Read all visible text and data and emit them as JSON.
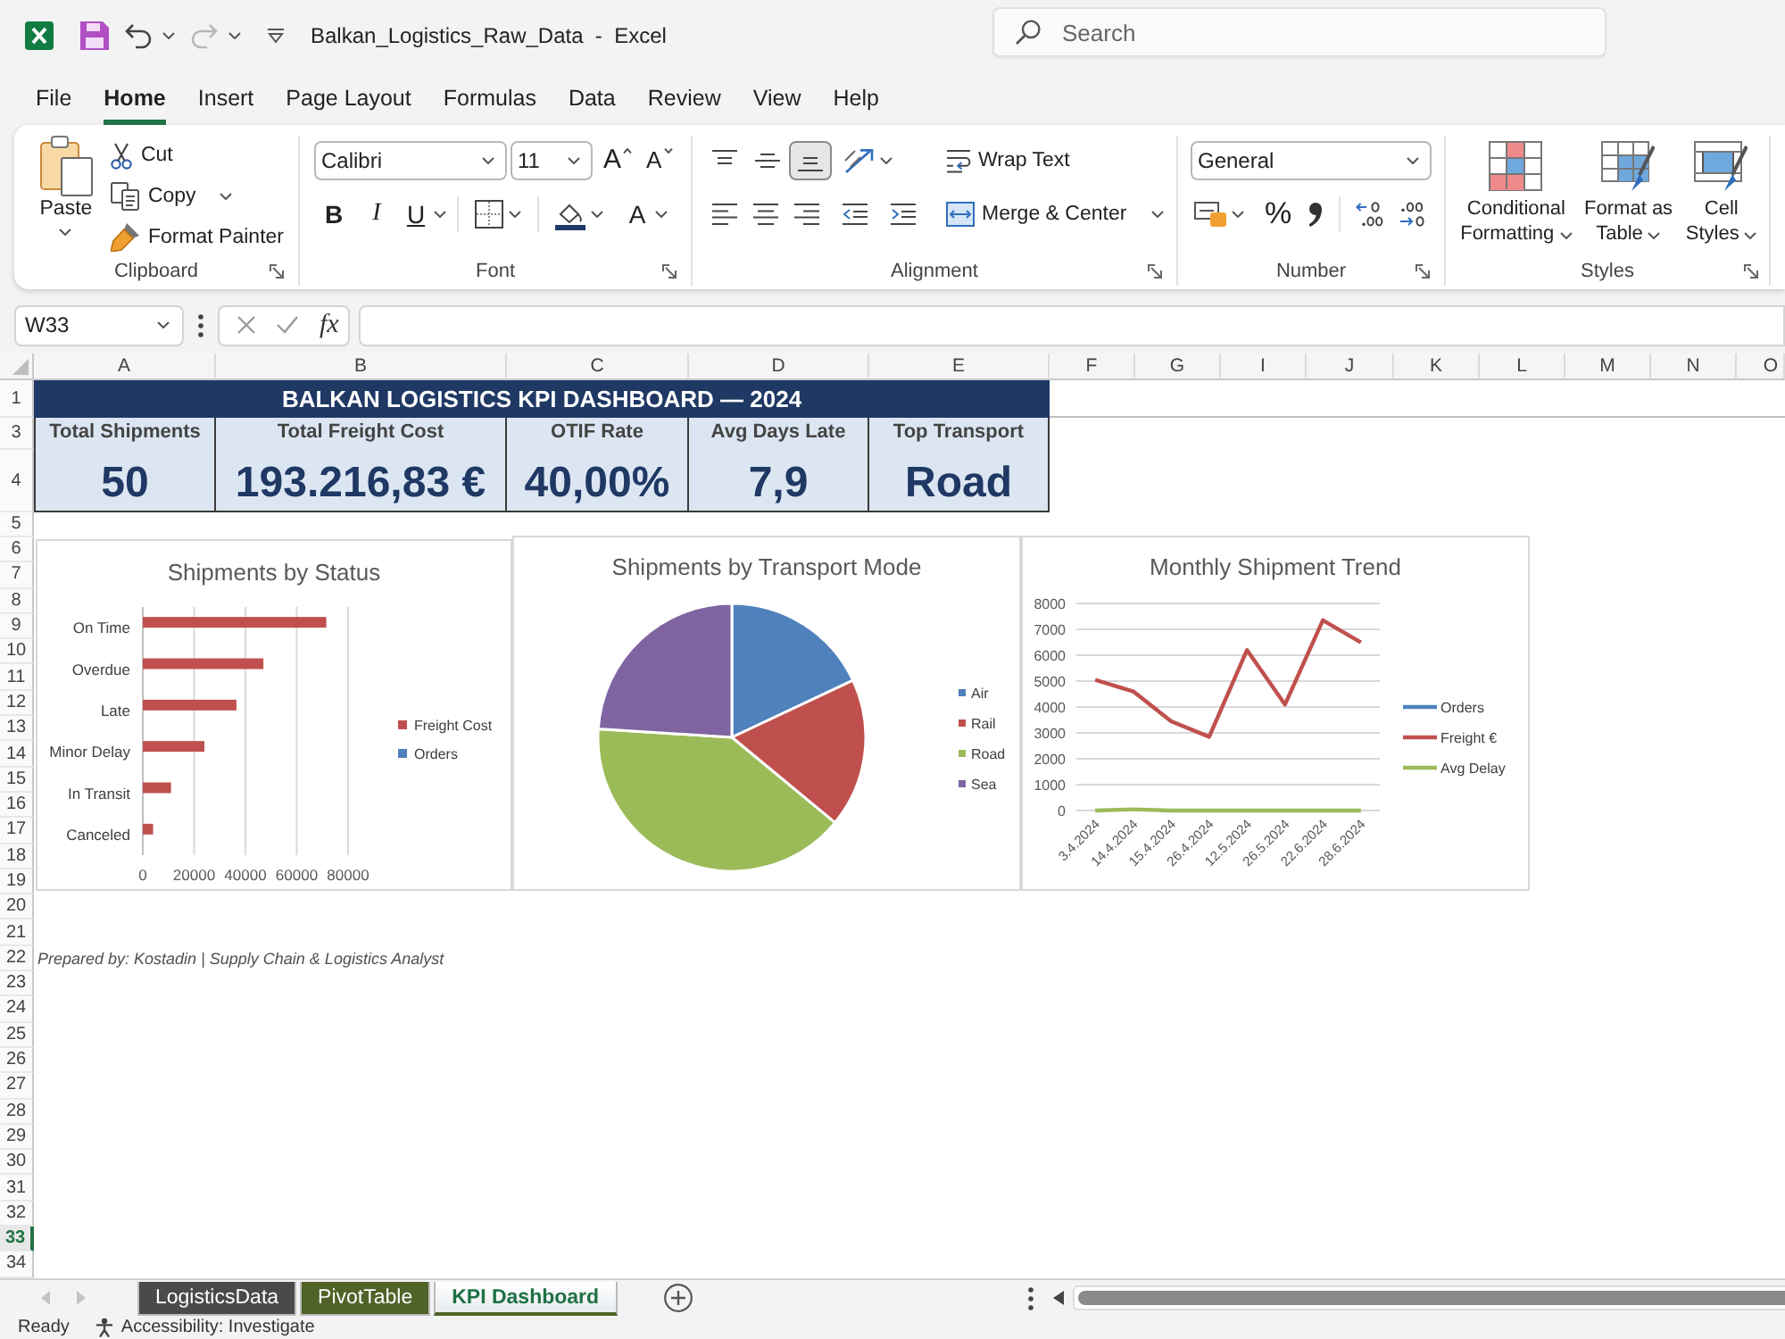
{
  "title_bar": {
    "title": "Balkan_Logistics_Raw_Data  -  Excel",
    "search": {
      "placeholder": "Search"
    }
  },
  "menu_tabs": [
    {
      "label": "File",
      "selected": false
    },
    {
      "label": "Home",
      "selected": true
    },
    {
      "label": "Insert",
      "selected": false
    },
    {
      "label": "Page Layout",
      "selected": false
    },
    {
      "label": "Formulas",
      "selected": false
    },
    {
      "label": "Data",
      "selected": false
    },
    {
      "label": "Review",
      "selected": false
    },
    {
      "label": "View",
      "selected": false
    },
    {
      "label": "Help",
      "selected": false
    }
  ],
  "ribbon": {
    "clipboard": {
      "paste": "Paste",
      "cut": "Cut",
      "copy": "Copy",
      "format_painter": "Format Painter",
      "label": "Clipboard"
    },
    "font": {
      "font_name": "Calibri",
      "font_size": "11",
      "grow_font": "A",
      "shrink_font": "A",
      "bold": "B",
      "italic": "I",
      "underline": "U",
      "font_color": "A",
      "label": "Font"
    },
    "alignment": {
      "vertical": [
        {
          "kind": "top",
          "selected": false
        },
        {
          "kind": "middle",
          "selected": false
        },
        {
          "kind": "bottom",
          "selected": true
        }
      ],
      "horizontal": [
        {
          "kind": "left",
          "selected": false
        },
        {
          "kind": "center",
          "selected": false
        },
        {
          "kind": "right",
          "selected": false
        }
      ],
      "wrap_text": "Wrap Text",
      "merge_center": "Merge & Center",
      "label": "Alignment"
    },
    "number": {
      "format": "General",
      "percent": "%",
      "label": "Number"
    },
    "styles": {
      "buttons": [
        {
          "kind": "conditional",
          "label": "Conditional Formatting"
        },
        {
          "kind": "table",
          "label": "Format as Table"
        },
        {
          "kind": "cell",
          "label": "Cell Styles"
        }
      ],
      "label": "Styles"
    }
  },
  "formula_bar": {
    "name_box": "W33",
    "function_button": "fx"
  },
  "sheet": {
    "columns": [
      "A",
      "B",
      "C",
      "D",
      "E",
      "F",
      "G",
      "I",
      "J",
      "K",
      "L",
      "M",
      "N",
      "O"
    ],
    "rows": [
      {
        "label": "1",
        "selected": false
      },
      {
        "label": "3",
        "selected": false
      },
      {
        "label": "4",
        "selected": false
      },
      {
        "label": "5",
        "selected": false
      },
      {
        "label": "6",
        "selected": false
      },
      {
        "label": "7",
        "selected": false
      },
      {
        "label": "8",
        "selected": false
      },
      {
        "label": "9",
        "selected": false
      },
      {
        "label": "10",
        "selected": false
      },
      {
        "label": "11",
        "selected": false
      },
      {
        "label": "12",
        "selected": false
      },
      {
        "label": "13",
        "selected": false
      },
      {
        "label": "14",
        "selected": false
      },
      {
        "label": "15",
        "selected": false
      },
      {
        "label": "16",
        "selected": false
      },
      {
        "label": "17",
        "selected": false
      },
      {
        "label": "18",
        "selected": false
      },
      {
        "label": "19",
        "selected": false
      },
      {
        "label": "20",
        "selected": false
      },
      {
        "label": "21",
        "selected": false
      },
      {
        "label": "22",
        "selected": false
      },
      {
        "label": "23",
        "selected": false
      },
      {
        "label": "24",
        "selected": false
      },
      {
        "label": "25",
        "selected": false
      },
      {
        "label": "26",
        "selected": false
      },
      {
        "label": "27",
        "selected": false
      },
      {
        "label": "28",
        "selected": false
      },
      {
        "label": "29",
        "selected": false
      },
      {
        "label": "30",
        "selected": false
      },
      {
        "label": "31",
        "selected": false
      },
      {
        "label": "32",
        "selected": false
      },
      {
        "label": "33",
        "selected": true
      },
      {
        "label": "34",
        "selected": false
      }
    ],
    "dashboard": {
      "title": "BALKAN LOGISTICS KPI DASHBOARD — 2024",
      "kpis": [
        {
          "label": "Total Shipments",
          "value": "50"
        },
        {
          "label": "Total Freight Cost",
          "value": "193.216,83 €"
        },
        {
          "label": "OTIF Rate",
          "value": "40,00%"
        },
        {
          "label": "Avg Days Late",
          "value": "7,9"
        },
        {
          "label": "Top Transport",
          "value": "Road"
        }
      ],
      "charts": [
        {
          "chart_data": {
            "type": "bar",
            "orientation": "horizontal",
            "title": "Shipments by Status",
            "categories": [
              "On Time",
              "Overdue",
              "Late",
              "Minor Delay",
              "In Transit",
              "Canceled"
            ],
            "series": [
              {
                "name": "Freight Cost",
                "color": "#c0504d",
                "values": [
                  71500,
                  47000,
                  36500,
                  24000,
                  11000,
                  4000
                ]
              },
              {
                "name": "Orders",
                "color": "#4f81bd",
                "values": [
                  null,
                  null,
                  null,
                  null,
                  null,
                  null
                ]
              }
            ],
            "xlim": [
              0,
              80000
            ],
            "xticks": [
              0,
              20000,
              40000,
              60000,
              80000
            ],
            "grid": true,
            "legend": "right"
          }
        },
        {
          "kind": "pie",
          "title": "Shipments by Transport Mode",
          "legend": [
            {
              "label": "Air",
              "color": "#4f81bd"
            },
            {
              "label": "Rail",
              "color": "#c0504d"
            },
            {
              "label": "Road",
              "color": "#9bbb59"
            },
            {
              "label": "Sea",
              "color": "#8064a2"
            }
          ]
        },
        {
          "chart_data": {
            "type": "line",
            "title": "Monthly Shipment Trend",
            "categories": [
              "3.4.2024",
              "14.4.2024",
              "15.4.2024",
              "26.4.2024",
              "12.5.2024",
              "26.5.2024",
              "22.6.2024",
              "28.6.2024"
            ],
            "series": [
              {
                "name": "Orders",
                "color": "#4f81bd",
                "values": [
                  null,
                  null,
                  null,
                  null,
                  null,
                  null,
                  null,
                  null
                ]
              },
              {
                "name": "Freight €",
                "color": "#c0504d",
                "values": [
                  5050,
                  4600,
                  3450,
                  2850,
                  6200,
                  4100,
                  7350,
                  6500
                ]
              },
              {
                "name": "Avg Delay",
                "color": "#9bbb59",
                "values": [
                  0,
                  50,
                  0,
                  0,
                  0,
                  0,
                  0,
                  0
                ]
              }
            ],
            "ylim": [
              0,
              8000
            ],
            "yticks": [
              0,
              1000,
              2000,
              3000,
              4000,
              5000,
              6000,
              7000,
              8000
            ],
            "grid": true,
            "legend": "right"
          }
        }
      ],
      "note": "Prepared by: Kostadin | Supply Chain & Logistics Analyst"
    }
  },
  "sheet_tabs": [
    {
      "label": "LogisticsData",
      "selected": false,
      "color": "#4a4a4a"
    },
    {
      "label": "PivotTable",
      "selected": false,
      "color": "#4f6228"
    },
    {
      "label": "KPI Dashboard",
      "selected": true,
      "color": "#4f6228"
    }
  ],
  "status_bar": {
    "ready": "Ready",
    "accessibility": "Accessibility: Investigate"
  }
}
